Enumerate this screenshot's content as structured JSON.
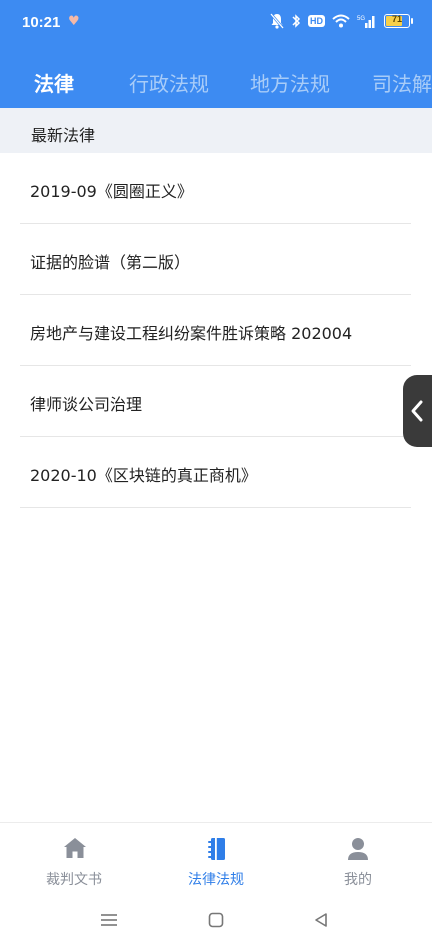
{
  "status_bar": {
    "time": "10:21",
    "battery": "71",
    "icons": [
      "heart-rate-icon",
      "mute-bell-icon",
      "bluetooth-icon",
      "hd-icon",
      "wifi-icon",
      "signal-icon",
      "battery-icon"
    ],
    "hd_label": "HD",
    "accent": "#3d8bf2"
  },
  "tabs": [
    {
      "label": "法律"
    },
    {
      "label": "行政法规"
    },
    {
      "label": "地方法规"
    },
    {
      "label": "司法解"
    }
  ],
  "section": {
    "title": "最新法律"
  },
  "list": [
    {
      "title": "2019-09《圆圈正义》"
    },
    {
      "title": "证据的脸谱（第二版）"
    },
    {
      "title": "房地产与建设工程纠纷案件胜诉策略 202004"
    },
    {
      "title": "律师谈公司治理"
    },
    {
      "title": "2020-10《区块链的真正商机》"
    }
  ],
  "bottom_nav": [
    {
      "label": "裁判文书",
      "icon": "home-icon"
    },
    {
      "label": "法律法规",
      "icon": "notebook-icon",
      "active": true
    },
    {
      "label": "我的",
      "icon": "person-icon"
    }
  ],
  "colors": {
    "active_nav": "#2f7ee8",
    "inactive_nav": "#8a8f99"
  }
}
